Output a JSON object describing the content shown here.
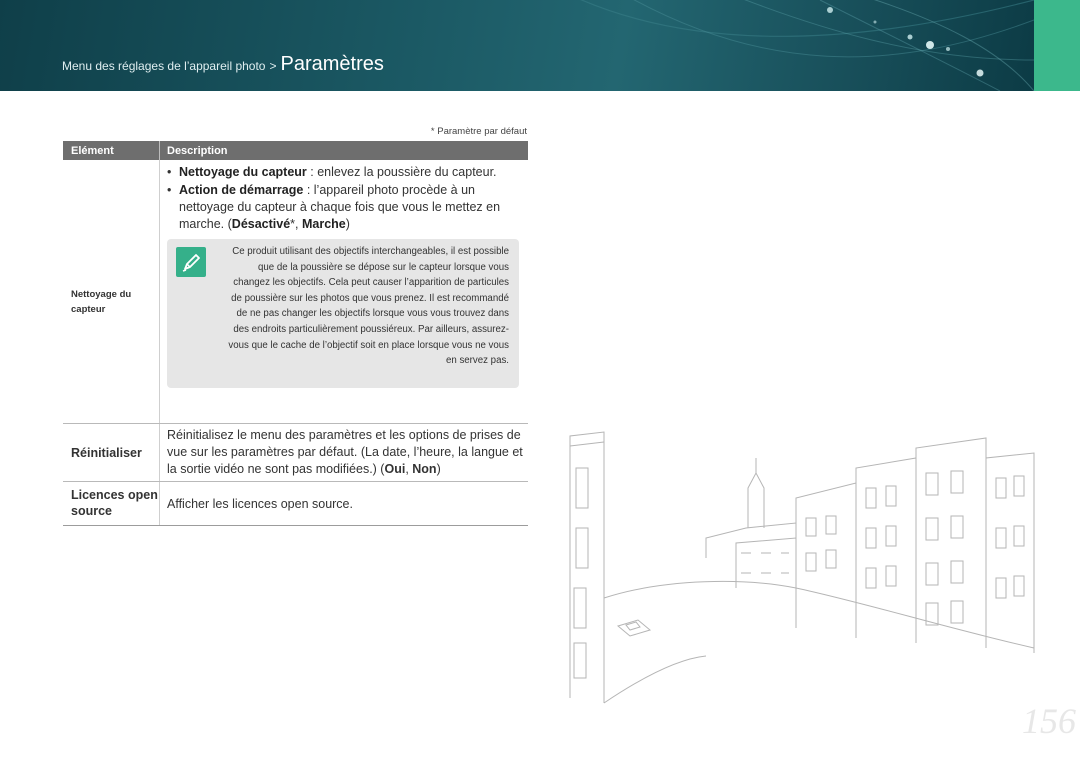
{
  "header": {
    "breadcrumb_small": "Menu des réglages de l’appareil photo",
    "breadcrumb_sep": ">",
    "breadcrumb_title": "Paramètres"
  },
  "default_note": "* Paramètre par défaut",
  "table": {
    "col_item": "Elément",
    "col_desc": "Description",
    "row1": {
      "item": "Nettoyage du capteur",
      "bullet1_bold": "Nettoyage du capteur",
      "bullet1_text": " : enlevez la poussière du capteur.",
      "bullet2_bold": "Action de démarrage",
      "bullet2_text": " : l’appareil photo procède à un nettoyage du capteur à chaque fois que vous le mettez en marche. (",
      "bullet2_opt1": "Désactivé",
      "bullet2_mid": "*, ",
      "bullet2_opt2": "Marche",
      "bullet2_end": ")",
      "note": "Ce produit utilisant des objectifs interchangeables, il est possible que de la poussière se dépose sur le capteur lorsque vous changez les objectifs. Cela peut causer l’apparition de particules de poussière sur les photos que vous prenez. Il est recommandé de ne pas changer les objectifs lorsque vous vous trouvez dans des endroits particulièrement poussiéreux. Par ailleurs, assurez-vous que le cache de l’objectif soit en place lorsque vous ne vous en servez pas."
    },
    "row2": {
      "item": "Réinitialiser",
      "desc_text": "Réinitialisez le menu des paramètres et les options de prises de vue sur les paramètres par défaut. (La date, l’heure, la langue et la sortie vidéo ne sont pas modifiées.) (",
      "opt1": "Oui",
      "sep": ", ",
      "opt2": "Non",
      "end": ")"
    },
    "row3": {
      "item": "Licences open source",
      "desc": "Afficher les licences open source."
    }
  },
  "page_number": "156",
  "colors": {
    "header": "#1b5964",
    "accent_green": "#3cb88c",
    "table_header": "#6e6e6e",
    "note_bg": "#e6e6e6"
  },
  "icons": [
    "pencil-note-icon"
  ]
}
